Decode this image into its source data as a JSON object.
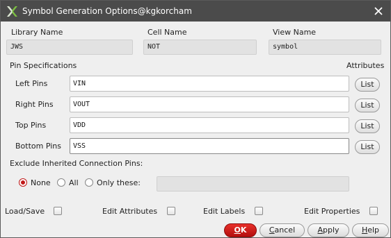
{
  "window": {
    "title": "Symbol Generation Options@kgkorcham"
  },
  "header": {
    "library": {
      "label": "Library Name",
      "value": "JWS"
    },
    "cell": {
      "label": "Cell Name",
      "value": "NOT"
    },
    "view": {
      "label": "View Name",
      "value": "symbol"
    }
  },
  "pins": {
    "section_label": "Pin Specifications",
    "attributes_label": "Attributes",
    "list_label": "List",
    "left": {
      "label": "Left Pins",
      "value": "VIN"
    },
    "right": {
      "label": "Right Pins",
      "value": "VOUT"
    },
    "top": {
      "label": "Top Pins",
      "value": "VDD"
    },
    "bottom": {
      "label": "Bottom Pins",
      "value": "VSS"
    }
  },
  "exclude": {
    "label": "Exclude Inherited Connection Pins:",
    "options": [
      "None",
      "All",
      "Only these:"
    ],
    "selected": "None",
    "only_these_value": ""
  },
  "edit_options": {
    "load_save": "Load/Save",
    "attributes": "Edit Attributes",
    "labels": "Edit Labels",
    "properties": "Edit Properties"
  },
  "buttons": {
    "ok_mnemonic": "O",
    "ok_rest": "K",
    "cancel_mnemonic": "C",
    "cancel_rest": "ancel",
    "apply_mnemonic": "A",
    "apply_rest": "pply",
    "help_mnemonic": "H",
    "help_rest": "elp"
  },
  "colors": {
    "titlebar": "#4b4b4b",
    "ok_button": "#c41a1a",
    "radio_selected": "#c01818"
  }
}
